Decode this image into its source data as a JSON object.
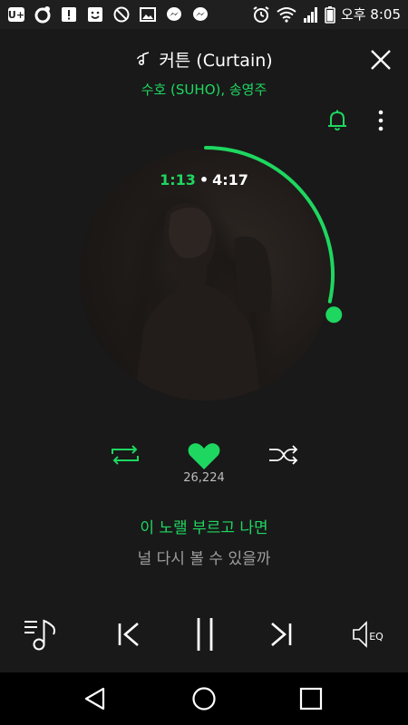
{
  "status_bar": {
    "notification_icons": [
      "u-plus-icon",
      "music-app-icon",
      "alert-icon",
      "face-icon",
      "block-icon",
      "image-icon",
      "messenger-icon",
      "messenger-icon"
    ],
    "status_icons": [
      "alarm-icon",
      "wifi-icon",
      "signal-icon",
      "battery-icon"
    ],
    "time": "오후 8:05"
  },
  "header": {
    "title": "커튼 (Curtain)",
    "artist": "수호 (SUHO), 송영주"
  },
  "player": {
    "current_time": "1:13",
    "separator": "•",
    "total_time": "4:17",
    "progress": 0.284,
    "like_count": "26,224",
    "liked": true
  },
  "lyrics": {
    "current": "이 노랠 부르고 나면",
    "next": "널 다시 볼 수 있을까"
  },
  "controls": {
    "eq_label": "EQ"
  },
  "colors": {
    "accent": "#1ed760",
    "background": "#191919"
  }
}
